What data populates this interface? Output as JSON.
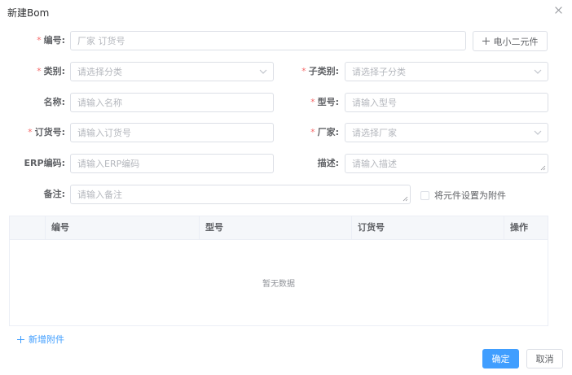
{
  "dialog": {
    "title": "新建Bom",
    "close_icon": "close-icon"
  },
  "form": {
    "required_mark": "*",
    "bianhao": {
      "label": "编号:",
      "placeholder": "厂家 订货号",
      "required": true
    },
    "electronic_button": {
      "label": "电小二元件",
      "icon": "plus-icon"
    },
    "leibie": {
      "label": "类别:",
      "placeholder": "请选择分类",
      "required": true
    },
    "zileibie": {
      "label": "子类别:",
      "placeholder": "请选择子分类",
      "required": true
    },
    "mingcheng": {
      "label": "名称:",
      "placeholder": "请输入名称",
      "required": false
    },
    "xinghao": {
      "label": "型号:",
      "placeholder": "请输入型号",
      "required": true
    },
    "dinghuohao": {
      "label": "订货号:",
      "placeholder": "请输入订货号",
      "required": true
    },
    "changjia": {
      "label": "厂家:",
      "placeholder": "请选择厂家",
      "required": true
    },
    "erp": {
      "label": "ERP编码:",
      "placeholder": "请输入ERP编码",
      "required": false
    },
    "miaoshu": {
      "label": "描述:",
      "placeholder": "请输入描述",
      "required": false
    },
    "beizhu": {
      "label": "备注:",
      "placeholder": "请输入备注",
      "required": false
    },
    "attachment_checkbox": {
      "label": "将元件设置为附件",
      "checked": false
    }
  },
  "table": {
    "columns": [
      "编号",
      "型号",
      "订货号",
      "操作"
    ],
    "rows": [],
    "empty_text": "暂无数据"
  },
  "add_attachment": {
    "label": "新增附件",
    "icon": "plus-icon"
  },
  "footer": {
    "confirm_label": "确定",
    "cancel_label": "取消"
  },
  "colors": {
    "primary": "#409eff",
    "required": "#f56c6c",
    "border": "#dcdfe6",
    "header_bg": "#f5f7fa"
  }
}
